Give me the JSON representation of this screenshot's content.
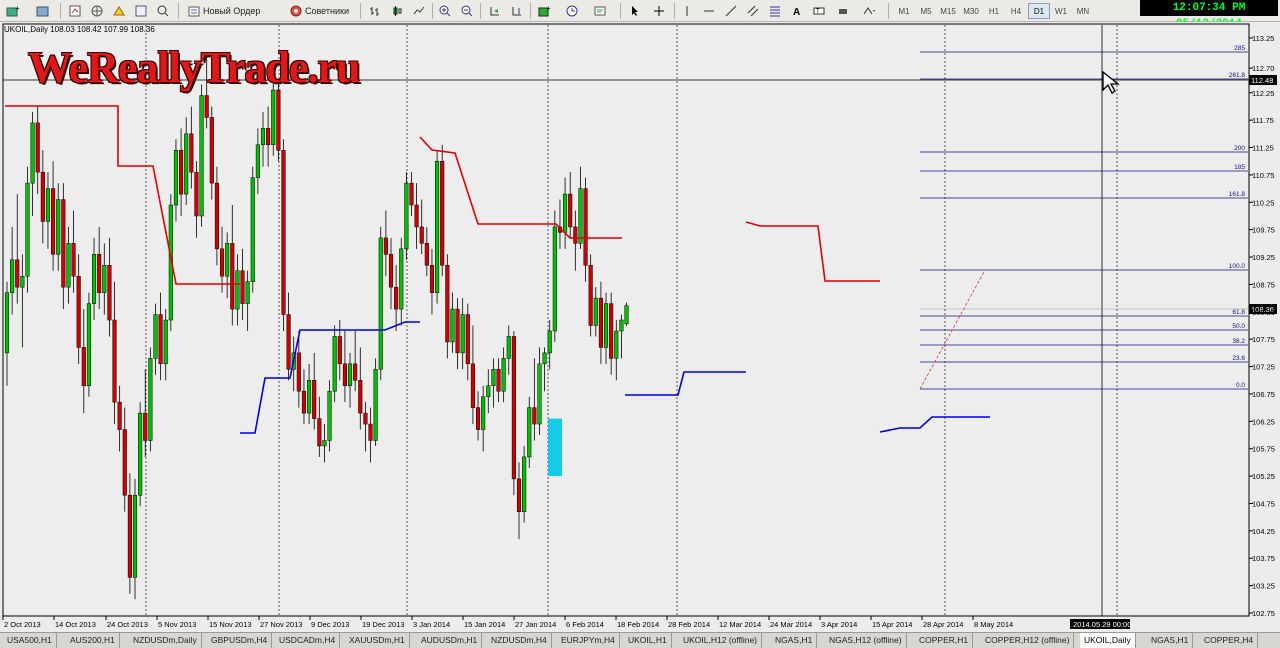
{
  "toolbar": {
    "new_order_label": "Новый Ордер",
    "advisors_label": "Советники",
    "timeframes": [
      "M1",
      "M5",
      "M15",
      "M30",
      "H1",
      "H4",
      "D1",
      "W1",
      "MN"
    ],
    "active_timeframe": "D1",
    "clock": "12:07:34 PM 05/12/2014"
  },
  "chart": {
    "info": "UKOIL,Daily  108.03 108.42 107.99 108.36",
    "watermark": "WeReallyTrade.ru",
    "current_price": "108.36",
    "crosshair_price": "112.48",
    "crosshair_date": "2014.05.29 00:00",
    "price_ticks": [
      "113.25",
      "112.70",
      "112.25",
      "111.75",
      "111.25",
      "110.75",
      "110.25",
      "109.75",
      "109.25",
      "108.75",
      "108.25",
      "107.75",
      "107.25",
      "106.75",
      "106.25",
      "105.75",
      "105.25",
      "104.75",
      "104.25",
      "103.75",
      "103.25",
      "102.75"
    ],
    "date_ticks": [
      "2 Oct 2013",
      "14 Oct 2013",
      "24 Oct 2013",
      "5 Nov 2013",
      "15 Nov 2013",
      "27 Nov 2013",
      "9 Dec 2013",
      "19 Dec 2013",
      "3 Jan 2014",
      "15 Jan 2014",
      "27 Jan 2014",
      "6 Feb 2014",
      "18 Feb 2014",
      "28 Feb 2014",
      "12 Mar 2014",
      "24 Mar 2014",
      "3 Apr 2014",
      "15 Apr 2014",
      "28 Apr 2014",
      "8 May 2014"
    ],
    "fib_levels": [
      "285",
      "261.8",
      "200",
      "185",
      "161.8",
      "100.0",
      "61.8",
      "50.0",
      "38.2",
      "23.6",
      "0.0"
    ]
  },
  "tabs": [
    "USA500,H1",
    "AUS200,H1",
    "NZDUSDm,Daily",
    "GBPUSDm,H4",
    "USDCADm,H4",
    "XAUUSDm,H1",
    "AUDUSDm,H1",
    "NZDUSDm,H4",
    "EURJPYm,H4",
    "UKOIL,H1",
    "UKOIL,H12 (offline)",
    "NGAS,H1",
    "NGAS,H12 (offline)",
    "COPPER,H1",
    "COPPER,H12 (offline)",
    "UKOIL,Daily",
    "NGAS,H1",
    "COPPER,H4"
  ],
  "active_tab": "UKOIL,Daily",
  "colors": {
    "bull": "#00c000",
    "bear": "#d00000",
    "stop_high": "#e00000",
    "stop_low": "#0000e0",
    "fib": "#101080",
    "highlight": "#00c8e8"
  }
}
